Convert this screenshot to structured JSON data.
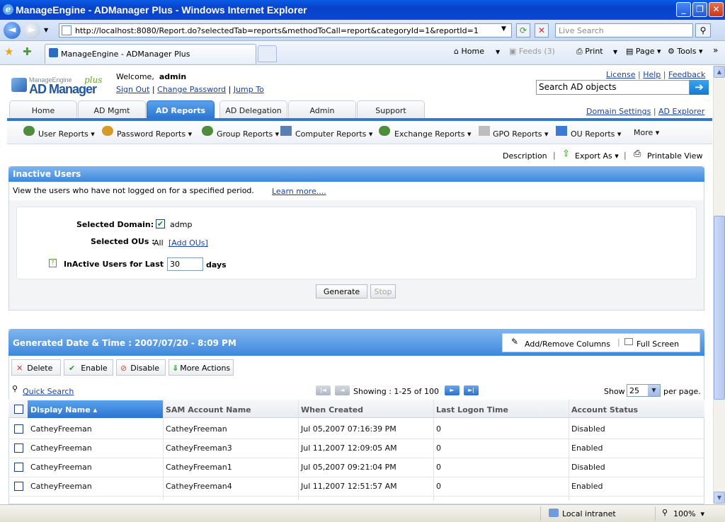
{
  "window": {
    "title": "ManageEngine - ADManager Plus - Windows Internet Explorer"
  },
  "browser": {
    "address": "http://localhost:8080/Report.do?selectedTab=reports&methodToCall=report&categoryId=1&reportId=1",
    "live_search_placeholder": "Live Search",
    "tab_title": "ManageEngine - ADManager Plus",
    "home": "Home",
    "feeds": "Feeds (3)",
    "print": "Print",
    "page": "Page",
    "tools": "Tools",
    "status_zone": "Local intranet",
    "zoom": "100%"
  },
  "header": {
    "logo_top": "ManageEngine",
    "logo_main": "AD Manager",
    "logo_plus": "plus",
    "welcome": "Welcome,",
    "user": "admin",
    "sign_out": "Sign Out",
    "change_password": "Change Password",
    "jump_to": "Jump To",
    "license": "License",
    "help": "Help",
    "feedback": "Feedback",
    "search_placeholder": "Search AD objects",
    "domain_settings": "Domain Settings",
    "ad_explorer": "AD Explorer"
  },
  "tabs": [
    "Home",
    "AD Mgmt",
    "AD Reports",
    "AD Delegation",
    "Admin",
    "Support"
  ],
  "submenu": [
    "User Reports",
    "Password Reports",
    "Group Reports",
    "Computer Reports",
    "Exchange Reports",
    "GPO Reports",
    "OU Reports",
    "More"
  ],
  "actions": {
    "description": "Description",
    "export_as": "Export As",
    "printable_view": "Printable View"
  },
  "report": {
    "title": "Inactive Users",
    "description": "View the users who have not logged on for a specified period.",
    "learn_more": "Learn more....",
    "selected_domain_label": "Selected Domain:",
    "domain": "admp",
    "selected_ous_label": "Selected OUs :",
    "ous": "All",
    "add_ous": "[Add OUs]",
    "inactive_label": "InActive Users for Last :",
    "days_value": "30",
    "days": "days",
    "generate": "Generate",
    "stop": "Stop"
  },
  "results": {
    "generated": "Generated Date & Time : 2007/07/20 - 8:09 PM",
    "add_remove_columns": "Add/Remove Columns",
    "full_screen": "Full Screen",
    "delete": "Delete",
    "enable": "Enable",
    "disable": "Disable",
    "more_actions": "More Actions",
    "quick_search": "Quick Search",
    "showing": "Showing : 1-25 of 100",
    "show": "Show",
    "page_size": "25",
    "per_page": "per page.",
    "columns": [
      "Display Name",
      "SAM Account Name",
      "When Created",
      "Last Logon Time",
      "Account Status"
    ],
    "rows": [
      [
        "CatheyFreeman",
        "CatheyFreeman",
        "Jul 05,2007 07:16:39 PM",
        "0",
        "Disabled"
      ],
      [
        "CatheyFreeman",
        "CatheyFreeman3",
        "Jul 11,2007 12:09:05 AM",
        "0",
        "Enabled"
      ],
      [
        "CatheyFreeman",
        "CatheyFreeman1",
        "Jul 05,2007 09:21:04 PM",
        "0",
        "Disabled"
      ],
      [
        "CatheyFreeman",
        "CatheyFreeman4",
        "Jul 11,2007 12:51:57 AM",
        "0",
        "Enabled"
      ]
    ]
  }
}
